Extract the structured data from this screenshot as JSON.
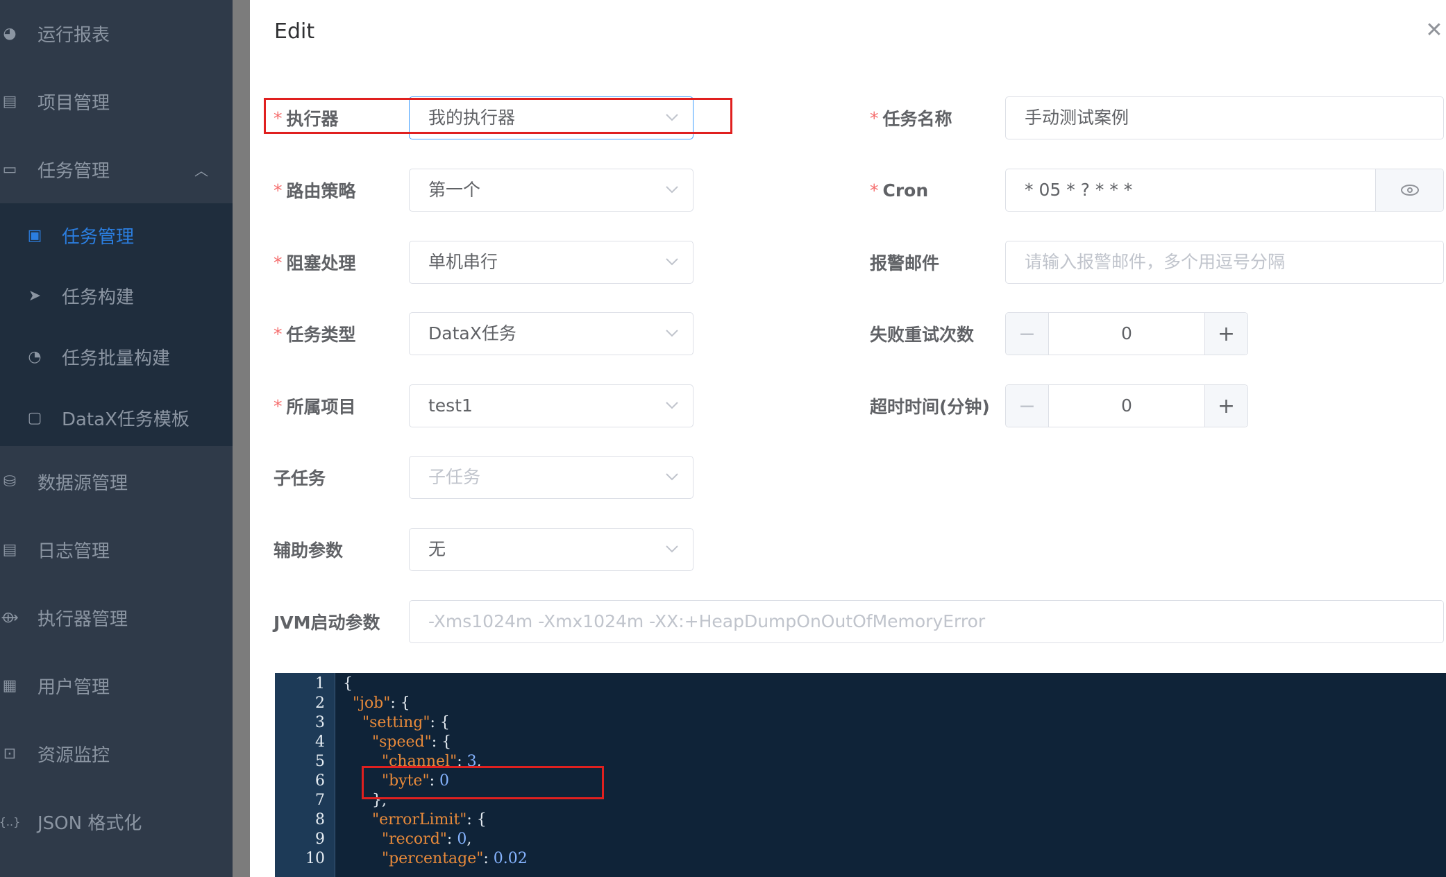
{
  "sidebar": {
    "items": [
      {
        "label": "运行报表",
        "icon": "dashboard-icon"
      },
      {
        "label": "项目管理",
        "icon": "folder-icon"
      },
      {
        "label": "任务管理",
        "icon": "monitor-icon"
      },
      {
        "label": "数据源管理",
        "icon": "database-icon"
      },
      {
        "label": "日志管理",
        "icon": "document-icon"
      },
      {
        "label": "执行器管理",
        "icon": "executor-icon"
      },
      {
        "label": "用户管理",
        "icon": "table-icon"
      },
      {
        "label": "资源监控",
        "icon": "monitor-resource-icon"
      },
      {
        "label": "JSON 格式化",
        "icon": "json-icon"
      }
    ],
    "submenu": [
      {
        "label": "任务管理",
        "icon": "calendar-icon",
        "active": true
      },
      {
        "label": "任务构建",
        "icon": "send-icon"
      },
      {
        "label": "任务批量构建",
        "icon": "gauge-icon"
      },
      {
        "label": "DataX任务模板",
        "icon": "clipboard-icon"
      }
    ]
  },
  "dialog": {
    "title": "Edit",
    "close_icon": "close-icon",
    "required_mark": "*",
    "left": {
      "executor": {
        "label": "执行器",
        "value": "我的执行器"
      },
      "route": {
        "label": "路由策略",
        "value": "第一个"
      },
      "block": {
        "label": "阻塞处理",
        "value": "单机串行"
      },
      "type": {
        "label": "任务类型",
        "value": "DataX任务"
      },
      "project": {
        "label": "所属项目",
        "value": "test1"
      },
      "child": {
        "label": "子任务",
        "placeholder": "子任务"
      },
      "aux": {
        "label": "辅助参数",
        "value": "无"
      }
    },
    "right": {
      "name": {
        "label": "任务名称",
        "value": "手动测试案例"
      },
      "cron": {
        "label": "Cron",
        "value": "* 05 * ? * * *"
      },
      "email": {
        "label": "报警邮件",
        "placeholder": "请输入报警邮件，多个用逗号分隔"
      },
      "retry": {
        "label": "失败重试次数",
        "value": "0"
      },
      "timeout": {
        "label": "超时时间(分钟)",
        "value": "0"
      }
    },
    "jvm": {
      "label": "JVM启动参数",
      "placeholder": "-Xms1024m -Xmx1024m -XX:+HeapDumpOnOutOfMemoryError"
    }
  },
  "editor": {
    "line_numbers": [
      "1",
      "2",
      "3",
      "4",
      "5",
      "6",
      "7",
      "8",
      "9",
      "10"
    ],
    "lines": [
      {
        "indent": "",
        "key": "",
        "punct": "{",
        "value": "",
        "tail": ""
      },
      {
        "indent": "  ",
        "key": "\"job\"",
        "punct": ": {",
        "value": "",
        "tail": ""
      },
      {
        "indent": "    ",
        "key": "\"setting\"",
        "punct": ": {",
        "value": "",
        "tail": ""
      },
      {
        "indent": "      ",
        "key": "\"speed\"",
        "punct": ": {",
        "value": "",
        "tail": ""
      },
      {
        "indent": "        ",
        "key": "\"channel\"",
        "punct": ": ",
        "value": "3",
        "tail": ","
      },
      {
        "indent": "        ",
        "key": "\"byte\"",
        "punct": ": ",
        "value": "0",
        "tail": ""
      },
      {
        "indent": "      ",
        "key": "",
        "punct": "},",
        "value": "",
        "tail": ""
      },
      {
        "indent": "      ",
        "key": "\"errorLimit\"",
        "punct": ": {",
        "value": "",
        "tail": ""
      },
      {
        "indent": "        ",
        "key": "\"record\"",
        "punct": ": ",
        "value": "0",
        "tail": ","
      },
      {
        "indent": "        ",
        "key": "\"percentage\"",
        "punct": ": ",
        "value": "0.02",
        "tail": ""
      }
    ]
  },
  "colors": {
    "accent": "#409eff",
    "required": "#f56c6c",
    "highlight_box": "#e0201f",
    "sidebar": "#2f3a49"
  }
}
